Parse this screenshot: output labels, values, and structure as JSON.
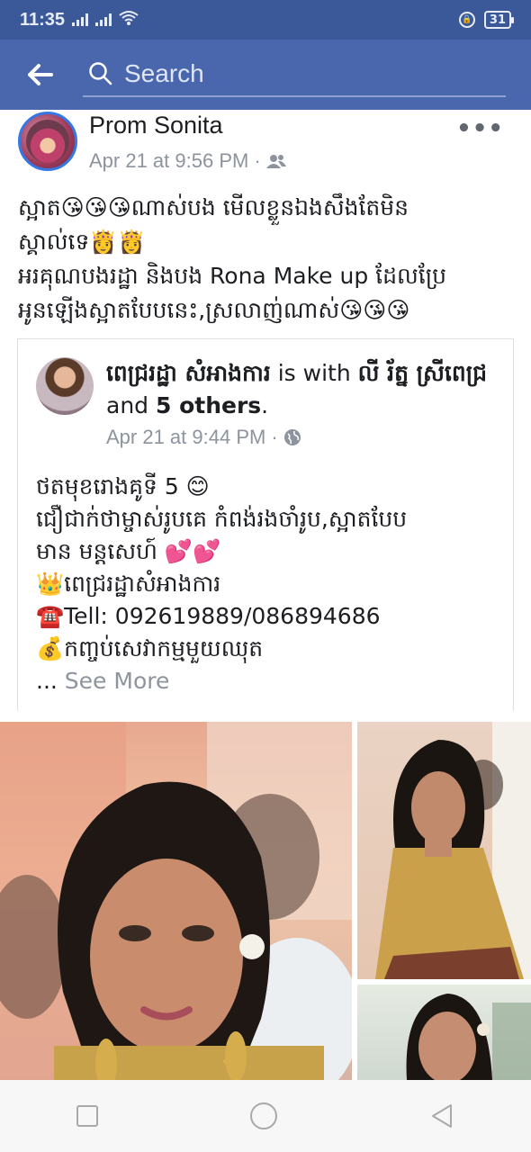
{
  "status_bar": {
    "time": "11:35",
    "battery": "31",
    "icons": [
      "signal-icon",
      "signal-icon",
      "wifi-icon",
      "lock-icon",
      "battery-icon"
    ]
  },
  "header": {
    "back_icon": "arrow-left-icon",
    "search_placeholder": "Search"
  },
  "post": {
    "author": "Prom Sonita",
    "date": "Apr 21 at 9:56 PM",
    "audience_icon": "friends-icon",
    "caption_lines": [
      "ស្អាត😘😘😘ណាស់បង មើលខ្លួនឯងសឹងតែមិន",
      "ស្គាល់ទេ👸👸",
      "អរគុណបងរដ្ឋា និងបង Rona Make up ដែលប្រែ",
      "អូនឡើងស្អាតបែបនេះ,ស្រលាញ់ណាស់😘😘😘"
    ]
  },
  "shared_post": {
    "author_name": "ពេជ្ររដ្ឋា សំអាងការ",
    "with_text": " is with ",
    "tagged": "លី រ័ត្ន ស្រីពេជ្រ",
    "and_text": " and ",
    "others": "5 others",
    "end": ".",
    "date": "Apr 21 at 9:44 PM",
    "audience_icon": "globe-icon",
    "body_lines": [
      "ថតមុខរោងគូទី 5 😊",
      "ជឿជាក់ថាម្ចាស់រូបគេ កំពង់រងចាំរូប,ស្អាតបែប",
      "មាន មន្តសេហ៍ 💕💕",
      "👑ពេជ្ររដ្ឋាសំអាងការ",
      "☎️Tell: 092619889/086894686",
      "💰កញ្ចប់សេវាកម្មមួយឈុត"
    ],
    "ellipsis": "... ",
    "see_more": "See More"
  },
  "nav": {
    "icons": [
      "recent-apps-icon",
      "home-icon",
      "back-icon"
    ]
  }
}
